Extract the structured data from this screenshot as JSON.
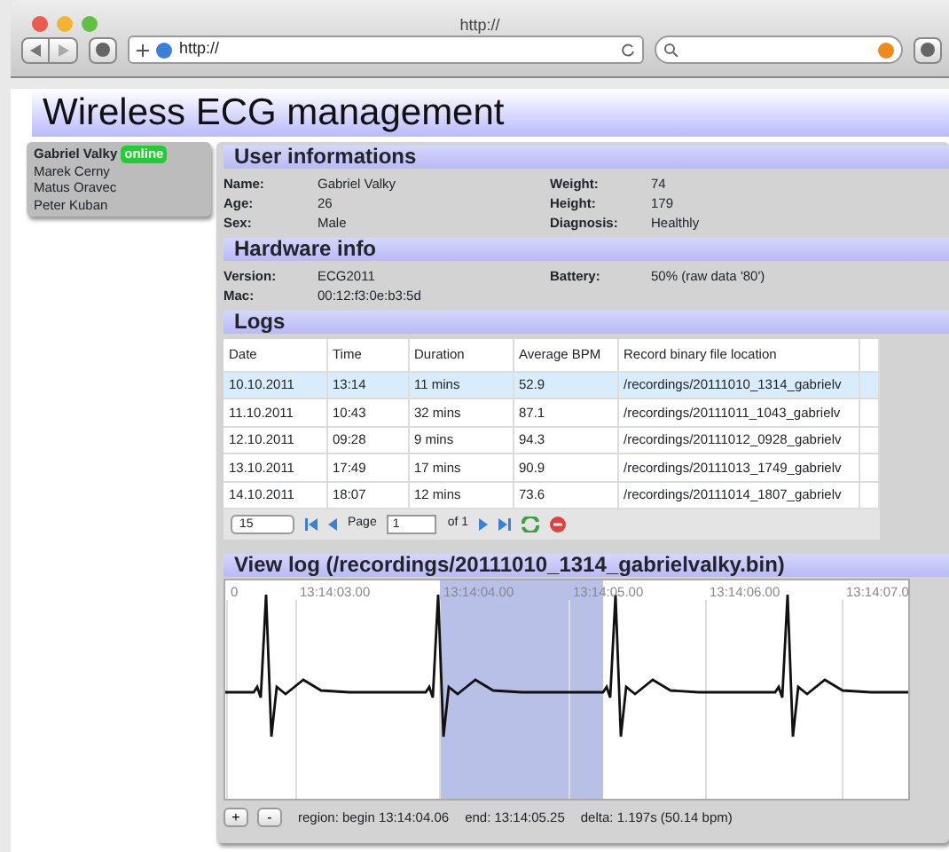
{
  "browser": {
    "title": "http://",
    "address": "http://"
  },
  "header": {
    "title": "Wireless ECG management"
  },
  "sidebar": {
    "users": [
      {
        "name": "Gabriel Valky",
        "selected": true,
        "status": "online"
      },
      {
        "name": "Marek Cerny",
        "selected": false
      },
      {
        "name": "Matus Oravec",
        "selected": false
      },
      {
        "name": "Peter Kuban",
        "selected": false
      }
    ]
  },
  "user_info": {
    "title": "User informations",
    "fields": [
      {
        "label": "Name:",
        "value": "Gabriel Valky"
      },
      {
        "label": "Weight:",
        "value": "74"
      },
      {
        "label": "Age:",
        "value": "26"
      },
      {
        "label": "Height:",
        "value": "179"
      },
      {
        "label": "Sex:",
        "value": "Male"
      },
      {
        "label": "Diagnosis:",
        "value": "Healthly"
      }
    ]
  },
  "hardware_info": {
    "title": "Hardware info",
    "fields": [
      {
        "label": "Version:",
        "value": "ECG2011"
      },
      {
        "label": "Battery:",
        "value": "50% (raw data '80')"
      },
      {
        "label": "Mac:",
        "value": "00:12:f3:0e:b3:5d"
      }
    ]
  },
  "logs": {
    "title": "Logs",
    "columns": [
      "Date",
      "Time",
      "Duration",
      "Average BPM",
      "Record binary file location"
    ],
    "rows": [
      {
        "cells": [
          "10.10.2011",
          "13:14",
          "11 mins",
          "52.9",
          "/recordings/20111010_1314_gabrielv"
        ],
        "selected": true
      },
      {
        "cells": [
          "11.10.2011",
          "10:43",
          "32 mins",
          "87.1",
          "/recordings/20111011_1043_gabrielv"
        ],
        "selected": false
      },
      {
        "cells": [
          "12.10.2011",
          "09:28",
          "9 mins",
          "94.3",
          "/recordings/20111012_0928_gabrielv"
        ],
        "selected": false
      },
      {
        "cells": [
          "13.10.2011",
          "17:49",
          "17 mins",
          "90.9",
          "/recordings/20111013_1749_gabrielv"
        ],
        "selected": false
      },
      {
        "cells": [
          "14.10.2011",
          "18:07",
          "12 mins",
          "73.6",
          "/recordings/20111014_1807_gabrielv"
        ],
        "selected": false
      }
    ],
    "pager": {
      "page_size": "15",
      "page_label": "Page",
      "page": "1",
      "of": "of 1"
    }
  },
  "view_log": {
    "title": "View log (/recordings/20111010_1314_gabrielvalky.bin)",
    "ticks": [
      "0",
      "13:14:03.00",
      "13:14:04.00",
      "13:14:05.00",
      "13:14:06.00",
      "13:14:07.0"
    ],
    "buttons": [
      "+",
      "-"
    ],
    "status": [
      "region: begin 13:14:04.06",
      "end: 13:14:05.25",
      "delta: 1.197s (50.14 bpm)"
    ]
  }
}
